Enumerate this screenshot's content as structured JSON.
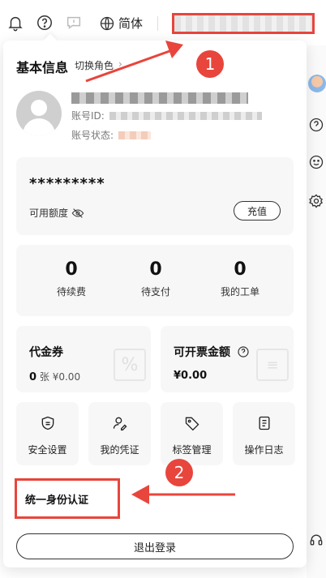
{
  "topbar": {
    "language_label": "简体",
    "icons": [
      "bell-icon",
      "help-icon",
      "message-icon",
      "globe-icon"
    ]
  },
  "panel": {
    "title": "基本信息",
    "switch_role": "切换角色",
    "account_id_label": "账号ID:",
    "account_status_label": "账号状态:",
    "balance_masked": "*********",
    "available_credit": "可用额度",
    "recharge": "充值",
    "stats": [
      {
        "value": "0",
        "label": "待续费"
      },
      {
        "value": "0",
        "label": "待支付"
      },
      {
        "value": "0",
        "label": "我的工单"
      }
    ],
    "coupon": {
      "title": "代金券",
      "count": "0",
      "unit": "张",
      "amount": "¥0.00"
    },
    "invoice": {
      "title": "可开票金额",
      "amount": "¥0.00"
    },
    "tiles": [
      {
        "label": "安全设置",
        "icon": "shield-icon"
      },
      {
        "label": "我的凭证",
        "icon": "user-key-icon"
      },
      {
        "label": "标签管理",
        "icon": "tag-icon"
      },
      {
        "label": "操作日志",
        "icon": "log-icon"
      }
    ],
    "unified_auth": "统一身份认证",
    "logout": "退出登录"
  },
  "annotations": {
    "badge1": "1",
    "badge2": "2",
    "color": "#e8453c"
  }
}
